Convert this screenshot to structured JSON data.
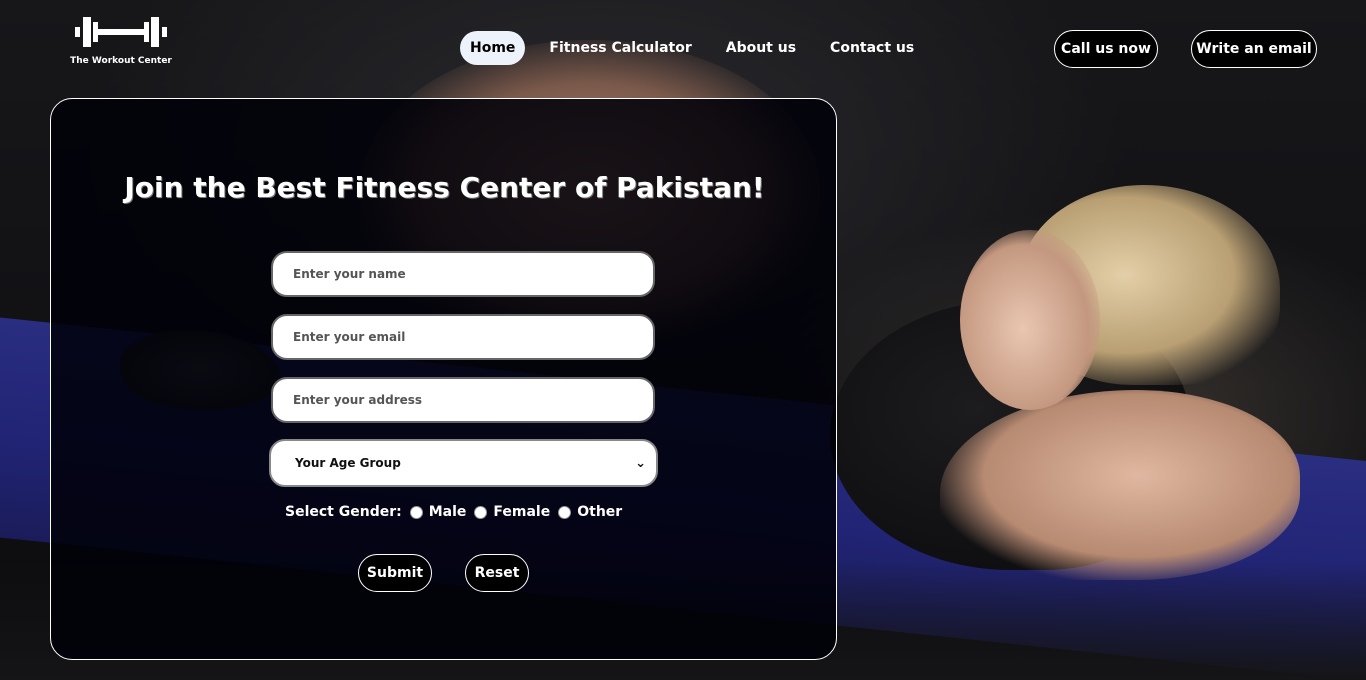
{
  "brand": {
    "name": "The Workout Center",
    "logo_icon": "dumbbell-icon"
  },
  "nav": {
    "items": [
      {
        "label": "Home",
        "active": true
      },
      {
        "label": "Fitness Calculator",
        "active": false
      },
      {
        "label": "About us",
        "active": false
      },
      {
        "label": "Contact us",
        "active": false
      }
    ]
  },
  "header_actions": {
    "call_label": "Call us now",
    "email_label": "Write an email"
  },
  "form": {
    "title": "Join the Best Fitness Center of Pakistan!",
    "name_placeholder": "Enter your name",
    "email_placeholder": "Enter your email",
    "address_placeholder": "Enter your address",
    "age_group_selected": "Your Age Group",
    "gender_label": "Select Gender:",
    "gender_options": [
      "Male",
      "Female",
      "Other"
    ],
    "submit_label": "Submit",
    "reset_label": "Reset"
  },
  "colors": {
    "card_bg": "#000008",
    "active_nav_bg": "#eef2fb",
    "mat": "#2b2f86"
  }
}
